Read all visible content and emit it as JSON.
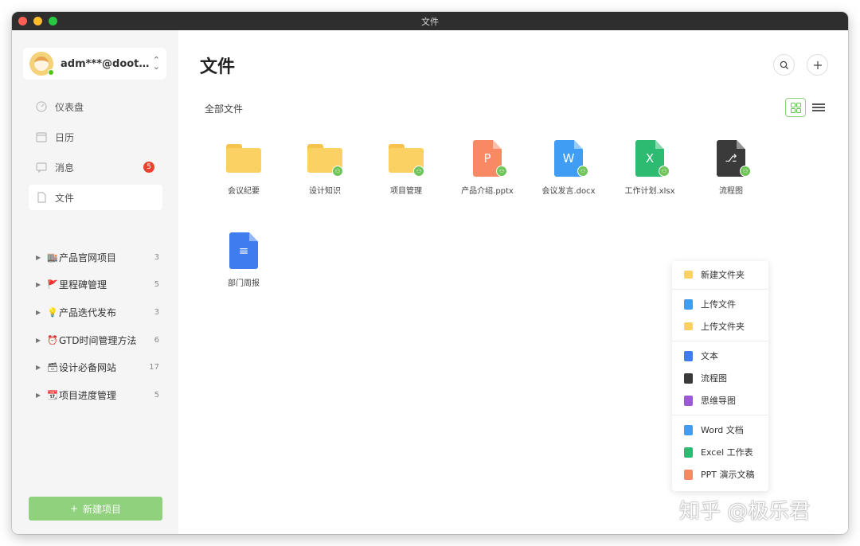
{
  "window": {
    "title": "文件"
  },
  "sidebar": {
    "account": {
      "email": "adm***@doot…",
      "chevron": "⌃⌄"
    },
    "nav": [
      {
        "label": "仪表盘",
        "icon": "dashboard-icon"
      },
      {
        "label": "日历",
        "icon": "calendar-icon"
      },
      {
        "label": "消息",
        "icon": "message-icon",
        "badge": "5"
      },
      {
        "label": "文件",
        "icon": "file-icon",
        "active": true
      }
    ],
    "projects": [
      {
        "emoji": "🏬",
        "label": "产品官网项目",
        "count": "3"
      },
      {
        "emoji": "🚩",
        "label": "里程碑管理",
        "count": "5"
      },
      {
        "emoji": "💡",
        "label": "产品迭代发布",
        "count": "3"
      },
      {
        "emoji": "⏰",
        "label": "GTD时间管理方法",
        "count": "6"
      },
      {
        "emoji": "🗃",
        "label": "设计必备网站",
        "count": "17"
      },
      {
        "emoji": "📆",
        "label": "项目进度管理",
        "count": "5"
      }
    ],
    "new_project": {
      "plus": "+",
      "label": "新建项目"
    }
  },
  "main": {
    "title": "文件",
    "breadcrumb": "全部文件",
    "files": [
      {
        "name": "会议纪要",
        "type": "folder"
      },
      {
        "name": "设计知识",
        "type": "folder",
        "shared": true
      },
      {
        "name": "项目管理",
        "type": "folder",
        "shared": true
      },
      {
        "name": "产品介绍.pptx",
        "type": "ppt",
        "letter": "P",
        "color": "#f78a65",
        "shared": true
      },
      {
        "name": "会议发言.docx",
        "type": "word",
        "letter": "W",
        "color": "#3f9ef4",
        "shared": true
      },
      {
        "name": "工作计划.xlsx",
        "type": "excel",
        "letter": "X",
        "color": "#2dbb72",
        "shared": true
      },
      {
        "name": "流程图",
        "type": "flowchart",
        "letter": "⎇",
        "color": "#3a3a3a",
        "shared": true
      },
      {
        "name": "部门周报",
        "type": "doc",
        "letter": "≡",
        "color": "#3e7cf0"
      }
    ]
  },
  "context_menu": {
    "groups": [
      [
        {
          "label": "新建文件夹",
          "color": "#fcd164"
        }
      ],
      [
        {
          "label": "上传文件",
          "color": "#3f9ef4"
        },
        {
          "label": "上传文件夹",
          "color": "#fcd164"
        }
      ],
      [
        {
          "label": "文本",
          "color": "#3e7cf0"
        },
        {
          "label": "流程图",
          "color": "#3a3a3a"
        },
        {
          "label": "思维导图",
          "color": "#9b59d6"
        }
      ],
      [
        {
          "label": "Word 文档",
          "color": "#3f9ef4"
        },
        {
          "label": "Excel 工作表",
          "color": "#2dbb72"
        },
        {
          "label": "PPT 演示文稿",
          "color": "#f78a65"
        }
      ]
    ]
  },
  "watermark": "知乎 @极乐君"
}
